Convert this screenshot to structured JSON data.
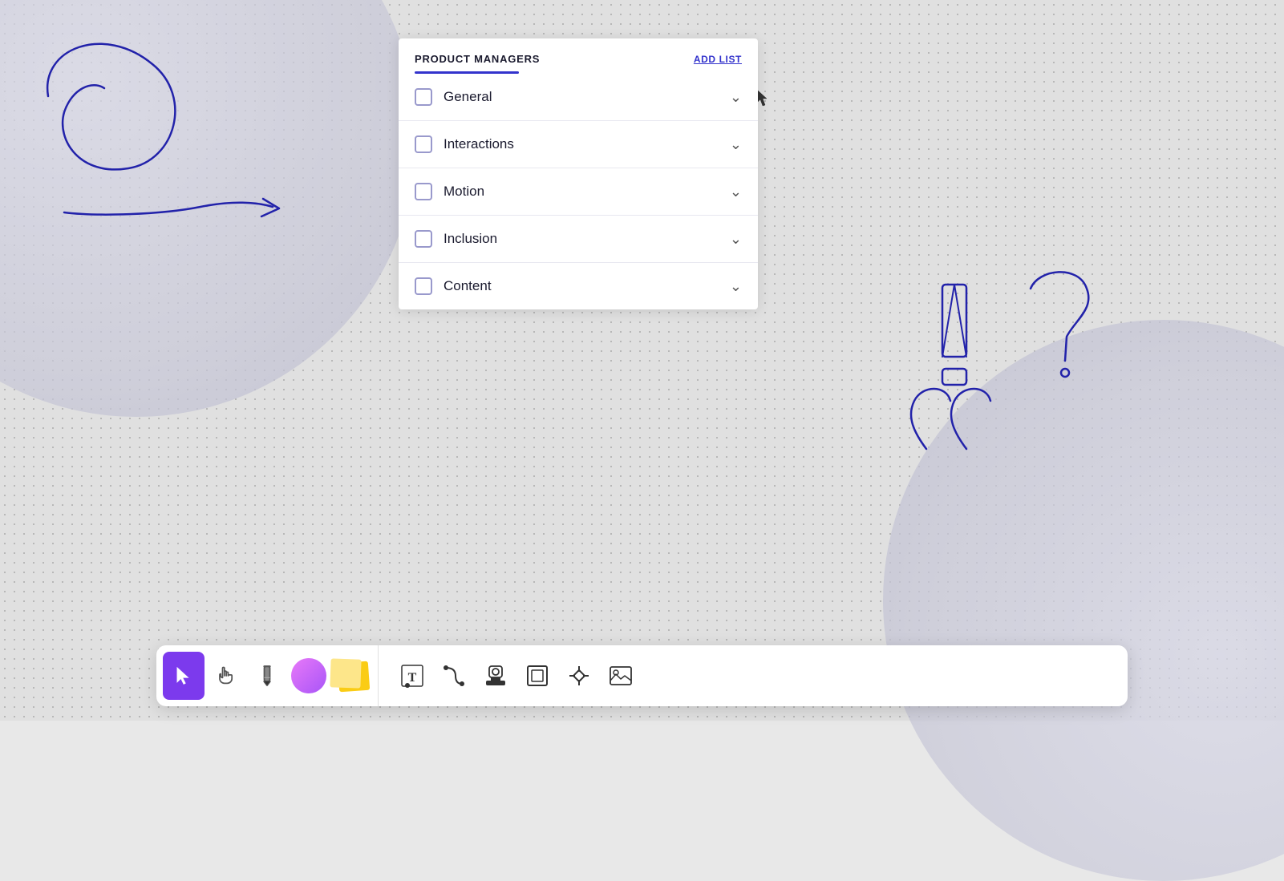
{
  "canvas": {
    "bg_color": "#d8d8d8"
  },
  "card": {
    "title": "PRODUCT MANAGERS",
    "add_list_label": "ADD LIST",
    "items": [
      {
        "id": "general",
        "label": "General",
        "checked": false
      },
      {
        "id": "interactions",
        "label": "Interactions",
        "checked": false
      },
      {
        "id": "motion",
        "label": "Motion",
        "checked": false
      },
      {
        "id": "inclusion",
        "label": "Inclusion",
        "checked": false
      },
      {
        "id": "content",
        "label": "Content",
        "checked": false
      }
    ]
  },
  "toolbar": {
    "tools_left": [
      {
        "id": "select",
        "label": "Select",
        "active": true,
        "icon": "cursor"
      },
      {
        "id": "hand",
        "label": "Hand tool",
        "active": false,
        "icon": "hand"
      },
      {
        "id": "pencil",
        "label": "Pencil",
        "active": false,
        "icon": "pencil"
      },
      {
        "id": "circle",
        "label": "Shape circle",
        "active": false,
        "icon": "circle-shape"
      },
      {
        "id": "sticky",
        "label": "Sticky notes",
        "active": false,
        "icon": "sticky-notes"
      }
    ],
    "tools_right": [
      {
        "id": "text",
        "label": "Text",
        "icon": "text-T"
      },
      {
        "id": "connector",
        "label": "Connector",
        "icon": "connector"
      },
      {
        "id": "stamp",
        "label": "Stamp",
        "icon": "stamp"
      },
      {
        "id": "frame",
        "label": "Frame",
        "icon": "frame"
      },
      {
        "id": "plugin",
        "label": "Plugin/Diamond",
        "icon": "diamond"
      },
      {
        "id": "image",
        "label": "Image",
        "icon": "image"
      }
    ]
  }
}
